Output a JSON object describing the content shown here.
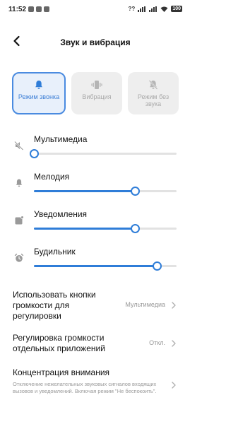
{
  "status_bar": {
    "time": "11:52",
    "network": "??",
    "battery": "100"
  },
  "header": {
    "title": "Звук и вибрация"
  },
  "modes": [
    {
      "label": "Режим звонка",
      "icon": "bell-icon",
      "active": true
    },
    {
      "label": "Вибрация",
      "icon": "vibration-icon",
      "active": false
    },
    {
      "label": "Режим без звука",
      "icon": "bell-off-icon",
      "active": false
    }
  ],
  "sliders": {
    "multimedia": {
      "label": "Мультимедиа",
      "icon": "speaker-muted-icon",
      "level": 0.0
    },
    "ringtone": {
      "label": "Мелодия",
      "icon": "bell-icon",
      "level": 0.71
    },
    "notifications": {
      "label": "Уведомления",
      "icon": "notification-icon",
      "level": 0.71
    },
    "alarm": {
      "label": "Будильник",
      "icon": "alarm-clock-icon",
      "level": 0.86
    }
  },
  "settings": {
    "volume_buttons": {
      "title": "Использовать кнопки громкости для регулировки",
      "value": "Мультимедиа"
    },
    "app_volume": {
      "title": "Регулировка громкости отдельных приложений",
      "value": "Откл."
    },
    "focus": {
      "title": "Концентрация внимания",
      "subtitle": "Отключение нежелательных звуковых сигналов входящих вызовов и уведомлений. Включая режим \"Не беспокоить\"."
    }
  },
  "colors": {
    "accent": "#2f7dd8",
    "active_card_bg": "#e8f0fb",
    "card_bg": "#eeeeee",
    "secondary_text": "#999999"
  }
}
